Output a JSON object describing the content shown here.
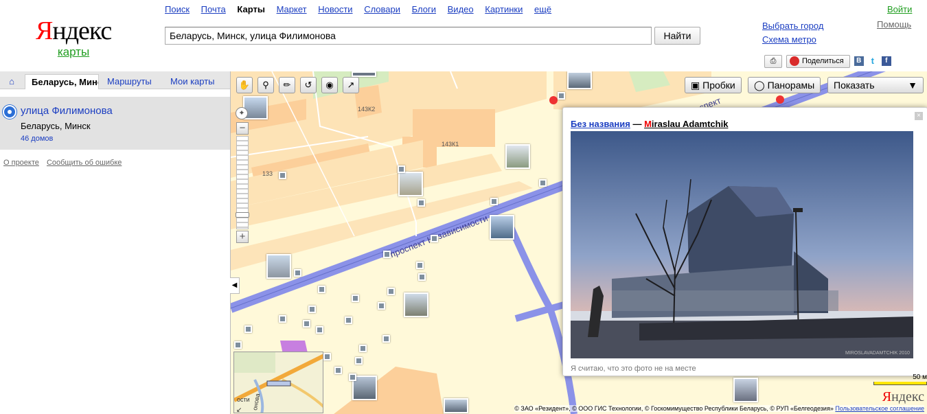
{
  "header": {
    "logo_first_letter": "Я",
    "logo_rest": "ндекс",
    "logo_sub": "карты",
    "services": [
      "Поиск",
      "Почта",
      "Карты",
      "Маркет",
      "Новости",
      "Словари",
      "Блоги",
      "Видео",
      "Картинки",
      "ещё"
    ],
    "active_service": "Карты",
    "search_value": "Беларусь, Минск, улица Филимонова",
    "search_button": "Найти",
    "login": "Войти",
    "choose_city": "Выбрать город",
    "metro_scheme": "Схема метро",
    "help": "Помощь",
    "print_icon": "printer-icon",
    "share_label": "Поделиться",
    "social": [
      "В",
      "t",
      "f"
    ]
  },
  "sidebar": {
    "home_icon": "home-icon",
    "tab_active": "Беларусь, Минск, улица Филимонова",
    "tab_routes": "Маршруты",
    "tab_my_maps": "Мои карты",
    "result": {
      "title": "улица Филимонова",
      "subtitle": "Беларусь, Минск",
      "count": "46 домов"
    },
    "about": "О проекте",
    "report_error": "Сообщить об ошибке"
  },
  "map": {
    "tools": [
      "hand-icon",
      "zoom-select-icon",
      "ruler-icon",
      "route-icon",
      "balloon-icon",
      "pointer-icon"
    ],
    "traffic_button": "Пробки",
    "panoramas_button": "Панорамы",
    "show_dropdown": "Показать",
    "labels": [
      "143К2",
      "143К1",
      "133"
    ],
    "street": "проспект Независимости",
    "street_short": "проспект",
    "minimap_label_1": "ости",
    "minimap_label_2": "онова",
    "scale_label": "50 м",
    "logo_first_letter": "Я",
    "logo_rest": "ндекс",
    "copyright": "© ЗАО «Резидент», © ООО ГИС Технологии, © Госкомимущество Республики Беларусь, © РУП «Белгеодезия»",
    "agreement": "Пользовательское соглашение"
  },
  "popup": {
    "title": "Без названия",
    "separator": " — ",
    "author_first": "M",
    "author_rest": "iraslau Adamtchik",
    "report": "Я считаю, что это фото не на месте",
    "watermark": "MIROSLAVADAMTCHIK 2010"
  },
  "colors": {
    "brand_red": "#ff0000",
    "link_blue": "#1a3dc1",
    "green": "#1f9d1f",
    "map_bg": "#fff9d9",
    "road_blue": "#8b92e8"
  }
}
